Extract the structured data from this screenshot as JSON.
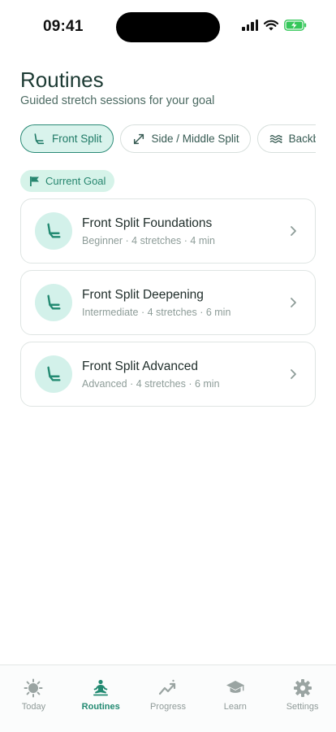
{
  "status_bar": {
    "time": "09:41"
  },
  "header": {
    "title": "Routines",
    "subtitle": "Guided stretch sessions for your goal"
  },
  "chips": [
    {
      "label": "Front Split",
      "icon": "front-split-icon",
      "active": true
    },
    {
      "label": "Side / Middle Split",
      "icon": "expand-arrows-icon",
      "active": false
    },
    {
      "label": "Backbend",
      "icon": "waves-icon",
      "active": false
    }
  ],
  "goal_badge": {
    "label": "Current Goal",
    "icon": "flag-icon"
  },
  "routines": [
    {
      "title": "Front Split Foundations",
      "meta": "Beginner · 4 stretches · 4 min"
    },
    {
      "title": "Front Split Deepening",
      "meta": "Intermediate · 4 stretches · 6 min"
    },
    {
      "title": "Front Split Advanced",
      "meta": "Advanced · 4 stretches · 6 min"
    }
  ],
  "tab_bar": [
    {
      "label": "Today",
      "icon": "sun-icon",
      "active": false
    },
    {
      "label": "Routines",
      "icon": "meditation-icon",
      "active": true
    },
    {
      "label": "Progress",
      "icon": "trend-icon",
      "active": false
    },
    {
      "label": "Learn",
      "icon": "graduation-cap-icon",
      "active": false
    },
    {
      "label": "Settings",
      "icon": "gear-icon",
      "active": false
    }
  ],
  "colors": {
    "accent": "#238a72",
    "accent_light": "#d3f1ea",
    "text_primary": "#1f2d2a",
    "text_muted": "#8d9c98"
  }
}
